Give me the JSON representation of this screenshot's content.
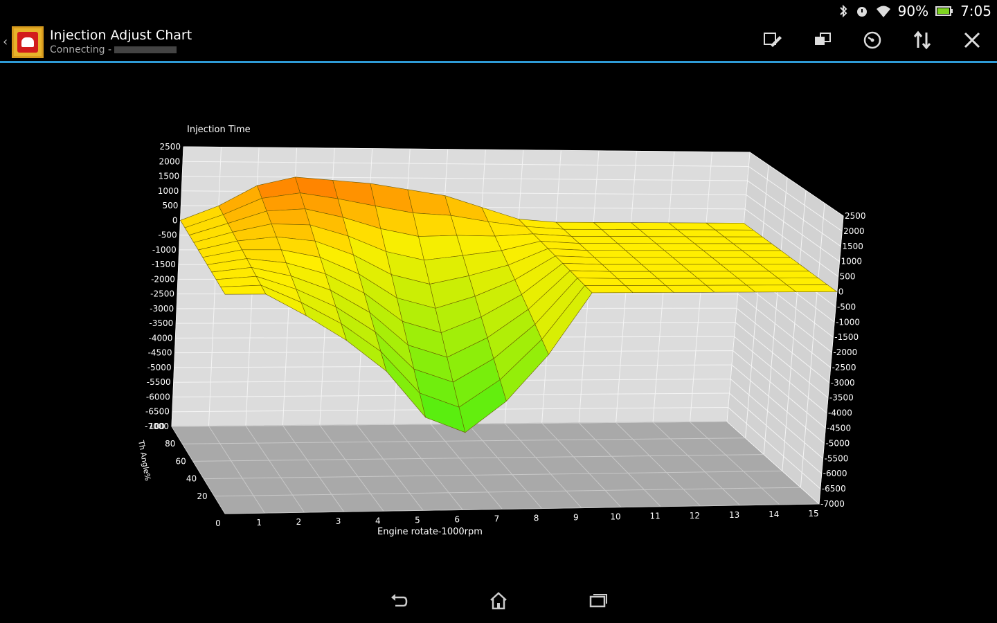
{
  "status": {
    "battery_percent": "90%",
    "time": "7:05"
  },
  "app": {
    "title": "Injection Adjust Chart",
    "subtitle": "Connecting -",
    "accent_color": "#2e9bd6"
  },
  "actions": [
    {
      "name": "edit-icon"
    },
    {
      "name": "transfer-icon"
    },
    {
      "name": "gauge-icon"
    },
    {
      "name": "sort-icon"
    },
    {
      "name": "tools-icon"
    }
  ],
  "navigation": [
    {
      "name": "back-icon"
    },
    {
      "name": "home-icon"
    },
    {
      "name": "recent-apps-icon"
    }
  ],
  "chart_data": {
    "type": "surface3d",
    "title": "Injection Time",
    "xlabel": "Engine rotate-1000rpm",
    "ylabel": "Th Angle%",
    "x_ticks": [
      "0",
      "1",
      "2",
      "3",
      "4",
      "5",
      "6",
      "7",
      "8",
      "9",
      "10",
      "11",
      "12",
      "13",
      "14",
      "15"
    ],
    "y_ticks": [
      "20",
      "40",
      "60",
      "80",
      "100"
    ],
    "z_ticks": [
      "2500",
      "2000",
      "1500",
      "1000",
      "500",
      "0",
      "-500",
      "-1000",
      "-1500",
      "-2000",
      "-2500",
      "-3000",
      "-3500",
      "-4000",
      "-4500",
      "-5000",
      "-5500",
      "-6000",
      "-6500",
      "-7000"
    ],
    "xlim": [
      0,
      15
    ],
    "ylim": [
      0,
      100
    ],
    "zlim": [
      -7000,
      2500
    ],
    "color_low": "#44ee11",
    "color_mid": "#ffee00",
    "color_high": "#ff6a00",
    "surface_profile": {
      "x": [
        0,
        1,
        2,
        3,
        4,
        5,
        6,
        7,
        8,
        9,
        10,
        11,
        12,
        13,
        14,
        15
      ],
      "front_values": [
        0,
        0,
        -700,
        -1500,
        -2500,
        -4000,
        -4500,
        -3500,
        -2000,
        0,
        0,
        0,
        0,
        0,
        0,
        0
      ],
      "back_values": [
        0,
        500,
        1200,
        1500,
        1400,
        1300,
        1100,
        900,
        500,
        100,
        0,
        0,
        0,
        0,
        0,
        0
      ]
    }
  }
}
